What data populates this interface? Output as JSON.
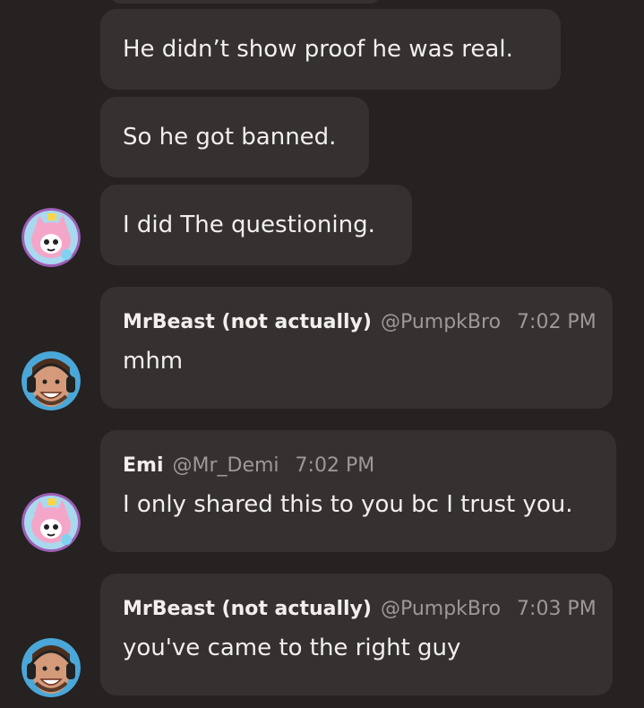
{
  "messages": [
    {
      "text": "He didn’t show proof he was real."
    },
    {
      "text": "So he got banned."
    },
    {
      "text": "I did The questioning.",
      "avatar": "pink-cartoon-avatar"
    },
    {
      "author": "MrBeast (not actually)",
      "handle": "@PumpkBro",
      "time": "7:02 PM",
      "text": "mhm",
      "avatar": "mrbeast-photo-avatar"
    },
    {
      "author": "Emi",
      "handle": "@Mr_Demi",
      "time": "7:02 PM",
      "text": "I only shared this to you bc I trust you.",
      "avatar": "pink-cartoon-avatar"
    },
    {
      "author": "MrBeast (not actually)",
      "handle": "@PumpkBro",
      "time": "7:03 PM",
      "text": "you've came to the right guy",
      "avatar": "mrbeast-photo-avatar"
    }
  ],
  "colors": {
    "background": "#252221",
    "bubble": "#343130",
    "text": "#f2efed",
    "muted": "#9e9996"
  }
}
